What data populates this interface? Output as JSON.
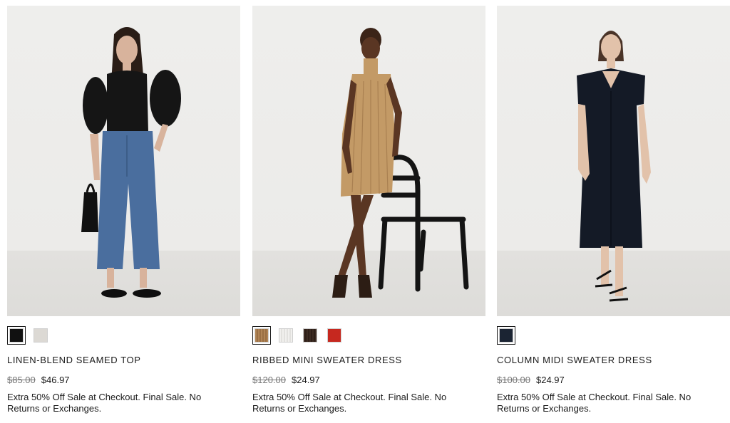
{
  "products": [
    {
      "name": "LINEN-BLEND SEAMED TOP",
      "price_original": "$85.00",
      "price_sale": "$46.97",
      "promo": "Extra 50% Off Sale at Checkout. Final Sale. No Returns or Exchanges.",
      "swatches": [
        {
          "name": "black",
          "color": "#111111",
          "selected": true
        },
        {
          "name": "ivory",
          "color": "#dcd9d4",
          "selected": false
        }
      ]
    },
    {
      "name": "RIBBED MINI SWEATER DRESS",
      "price_original": "$120.00",
      "price_sale": "$24.97",
      "promo": "Extra 50% Off Sale at Checkout. Final Sale. No Returns or Exchanges.",
      "swatches": [
        {
          "name": "camel",
          "color": "#b08456",
          "selected": true
        },
        {
          "name": "white",
          "color": "#f1f0ee",
          "selected": false
        },
        {
          "name": "brown",
          "color": "#3d2c23",
          "selected": false
        },
        {
          "name": "red",
          "color": "#c6281f",
          "selected": false
        }
      ]
    },
    {
      "name": "COLUMN MIDI SWEATER DRESS",
      "price_original": "$100.00",
      "price_sale": "$24.97",
      "promo": "Extra 50% Off Sale at Checkout. Final Sale. No Returns or Exchanges.",
      "swatches": [
        {
          "name": "navy",
          "color": "#1b2433",
          "selected": true
        }
      ]
    }
  ]
}
